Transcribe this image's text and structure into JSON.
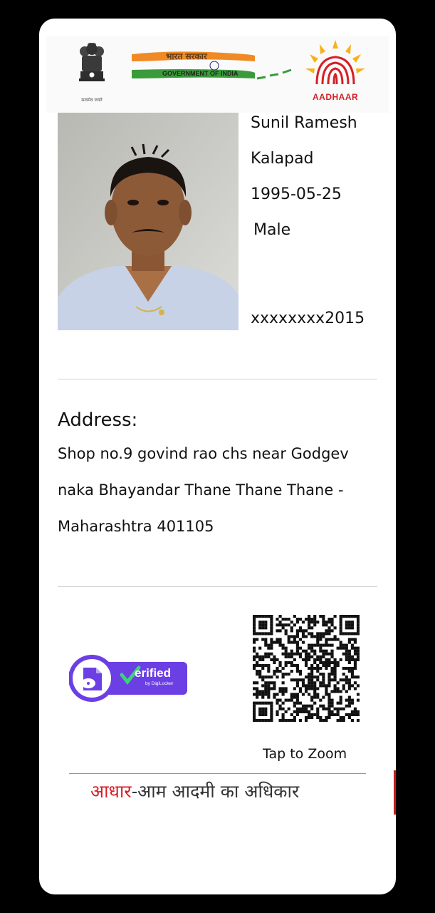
{
  "header": {
    "emblem_caption": "सत्यमेव जयते",
    "govt_hindi": "भारत सरकार",
    "govt_english": "GOVERNMENT OF INDIA",
    "aadhaar_brand": "AADHAAR"
  },
  "person": {
    "name_line1": "Sunil Ramesh",
    "name_line2": "Kalapad",
    "dob": "1995-05-25",
    "gender": "Male",
    "masked_aadhaar": "xxxxxxxx2015"
  },
  "address": {
    "label": "Address:",
    "lines": [
      "Shop no.9 govind rao chs near Godgev",
      "naka Bhayandar Thane Thane Thane -",
      "Maharashtra 401105"
    ]
  },
  "verification": {
    "badge_text": "erified",
    "badge_sub": "by DigiLocker"
  },
  "qr": {
    "tap_label": "Tap to Zoom"
  },
  "footer": {
    "slogan_red": "आधार",
    "slogan_rest": "-आम आदमी का अधिकार"
  },
  "colors": {
    "aadhaar_red": "#d61f26",
    "aadhaar_yellow": "#f6b21b",
    "badge_purple": "#6b3fe4",
    "saffron": "#f08a24",
    "green": "#3a9b3a"
  }
}
